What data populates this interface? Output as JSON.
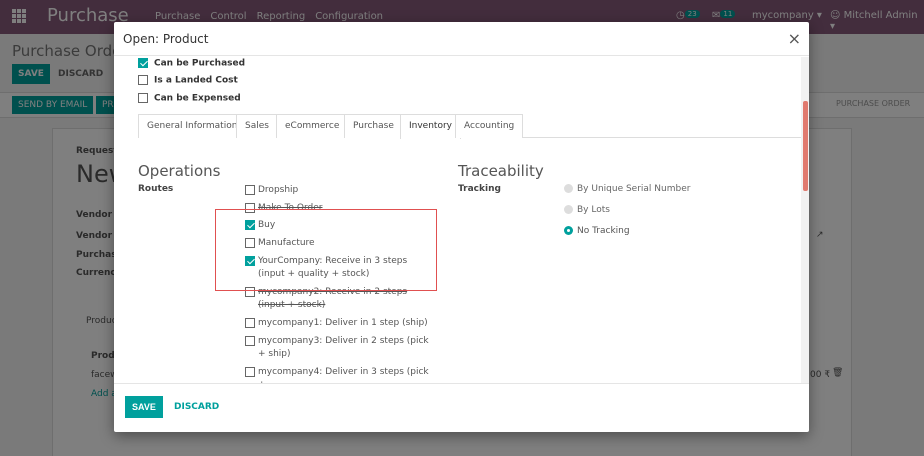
{
  "topbar": {
    "app_name": "Purchase",
    "menu": [
      "Purchase",
      "Control",
      "Reporting",
      "Configuration"
    ],
    "activity_count": "23",
    "message_count": "11",
    "company": "mycompany",
    "user": "Mitchell Admin"
  },
  "background": {
    "breadcrumb": "Purchase Orders /",
    "save_label": "SAVE",
    "discard_label": "DISCARD",
    "send_email_label": "SEND BY EMAIL",
    "print_label": "PR",
    "status_label": "PURCHASE ORDER",
    "request_label": "Request f",
    "new_title": "New",
    "vendor_label": "Vendor",
    "vendor_ref_label": "Vendor R",
    "purchase_label": "Purchase",
    "currency_label": "Currency",
    "products_tab": "Produc",
    "product_col": "Produ",
    "row_product": "facew",
    "add_line": "Add a",
    "row_amount": "00 ₹"
  },
  "modal": {
    "title": "Open: Product",
    "close_glyph": "×",
    "top_checkboxes": [
      {
        "label": "Can be Purchased",
        "checked": true
      },
      {
        "label": "Is a Landed Cost",
        "checked": false
      },
      {
        "label": "Can be Expensed",
        "checked": false
      }
    ],
    "tabs": [
      "General Information",
      "Sales",
      "eCommerce",
      "Purchase",
      "Inventory",
      "Accounting"
    ],
    "active_tab": "Inventory",
    "operations": {
      "title": "Operations",
      "routes_label": "Routes",
      "routes": [
        {
          "label": "Dropship",
          "checked": false
        },
        {
          "label": "Make To Order",
          "checked": false
        },
        {
          "label": "Buy",
          "checked": true
        },
        {
          "label": "Manufacture",
          "checked": false
        },
        {
          "label": "YourCompany: Receive in 3 steps (input + quality + stock)",
          "checked": true
        },
        {
          "label": "mycompany2: Receive in 2 steps (input + stock)",
          "checked": false
        },
        {
          "label": "mycompany1: Deliver in 1 step (ship)",
          "checked": false
        },
        {
          "label": "mycompany3: Deliver in 2 steps (pick + ship)",
          "checked": false
        },
        {
          "label": "mycompany4: Deliver in 3 steps (pick +",
          "checked": false
        }
      ]
    },
    "traceability": {
      "title": "Traceability",
      "tracking_label": "Tracking",
      "options": [
        {
          "label": "By Unique Serial Number",
          "selected": false
        },
        {
          "label": "By Lots",
          "selected": false
        },
        {
          "label": "No Tracking",
          "selected": true
        }
      ]
    },
    "footer": {
      "save_label": "SAVE",
      "discard_label": "DISCARD"
    }
  },
  "colors": {
    "brand": "#875a7b",
    "accent": "#00a09d",
    "highlight_box": "#e05050"
  }
}
